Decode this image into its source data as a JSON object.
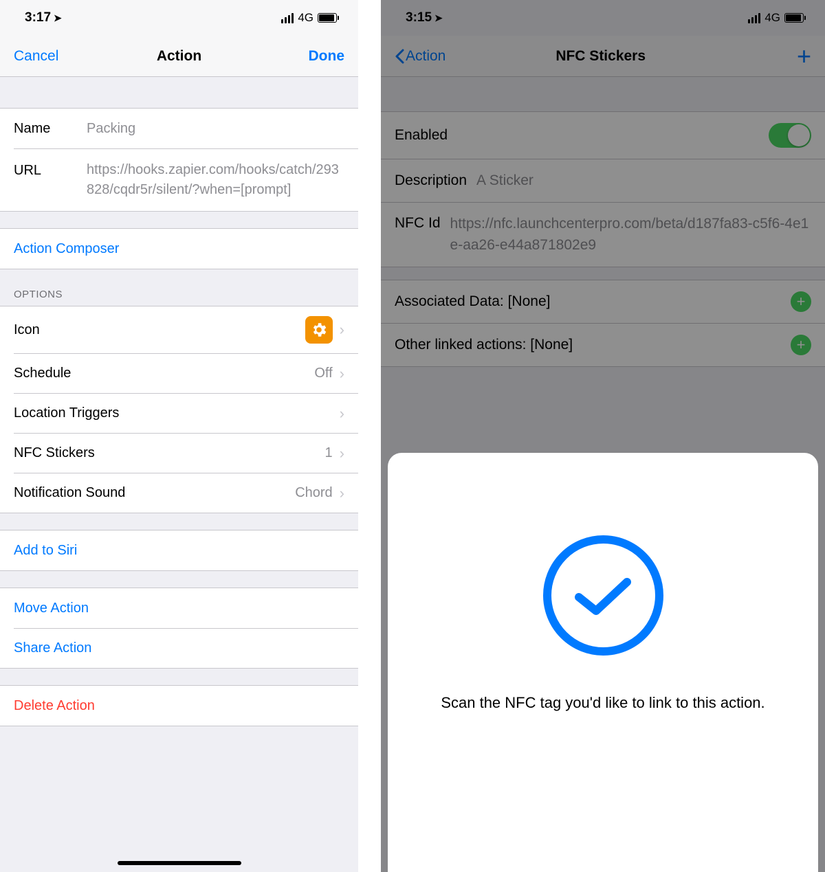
{
  "left": {
    "status": {
      "time": "3:17",
      "network": "4G"
    },
    "nav": {
      "cancel": "Cancel",
      "title": "Action",
      "done": "Done"
    },
    "form": {
      "name_label": "Name",
      "name_value": "Packing",
      "url_label": "URL",
      "url_value": "https://hooks.zapier.com/hooks/catch/293828/cqdr5r/silent/?when=[prompt]"
    },
    "composer": "Action Composer",
    "options_header": "OPTIONS",
    "options": {
      "icon": "Icon",
      "schedule": {
        "label": "Schedule",
        "value": "Off"
      },
      "location": "Location Triggers",
      "nfc": {
        "label": "NFC Stickers",
        "value": "1"
      },
      "sound": {
        "label": "Notification Sound",
        "value": "Chord"
      }
    },
    "siri": "Add to Siri",
    "move": "Move Action",
    "share": "Share Action",
    "delete": "Delete Action"
  },
  "right": {
    "status": {
      "time": "3:15",
      "network": "4G"
    },
    "nav": {
      "back": "Action",
      "title": "NFC Stickers"
    },
    "rows": {
      "enabled": "Enabled",
      "description_label": "Description",
      "description_value": "A Sticker",
      "nfcid_label": "NFC Id",
      "nfcid_value": "https://nfc.launchcenterpro.com/beta/d187fa83-c5f6-4e1e-aa26-e44a871802e9",
      "assoc": "Associated Data: [None]",
      "other": "Other linked actions: [None]"
    },
    "sheet": {
      "text": "Scan the NFC tag you'd like to link to this action."
    }
  }
}
